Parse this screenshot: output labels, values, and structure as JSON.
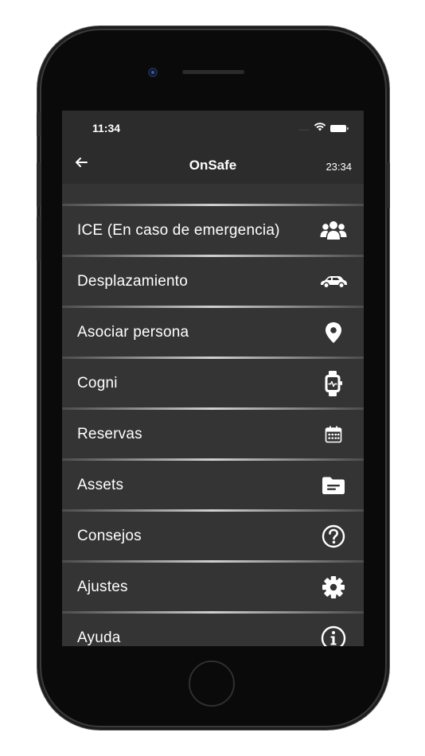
{
  "status_bar": {
    "time": "11:34",
    "signal": "....",
    "wifi_icon": "wifi-icon",
    "battery_icon": "battery-icon"
  },
  "header": {
    "back_icon": "arrow-left-icon",
    "title": "OnSafe",
    "clock": "23:34"
  },
  "menu": {
    "items": [
      {
        "label": "ICE (En caso de emergencia)",
        "icon": "users-icon"
      },
      {
        "label": "Desplazamiento",
        "icon": "car-icon"
      },
      {
        "label": "Asociar persona",
        "icon": "map-pin-icon"
      },
      {
        "label": "Cogni",
        "icon": "smartwatch-icon"
      },
      {
        "label": "Reservas",
        "icon": "calendar-icon"
      },
      {
        "label": "Assets",
        "icon": "folder-icon"
      },
      {
        "label": "Consejos",
        "icon": "question-circle-icon"
      },
      {
        "label": "Ajustes",
        "icon": "gear-icon"
      },
      {
        "label": "Ayuda",
        "icon": "info-circle-icon"
      }
    ]
  },
  "colors": {
    "background": "#343434",
    "bar": "#2c2c2c",
    "text": "#ffffff"
  }
}
